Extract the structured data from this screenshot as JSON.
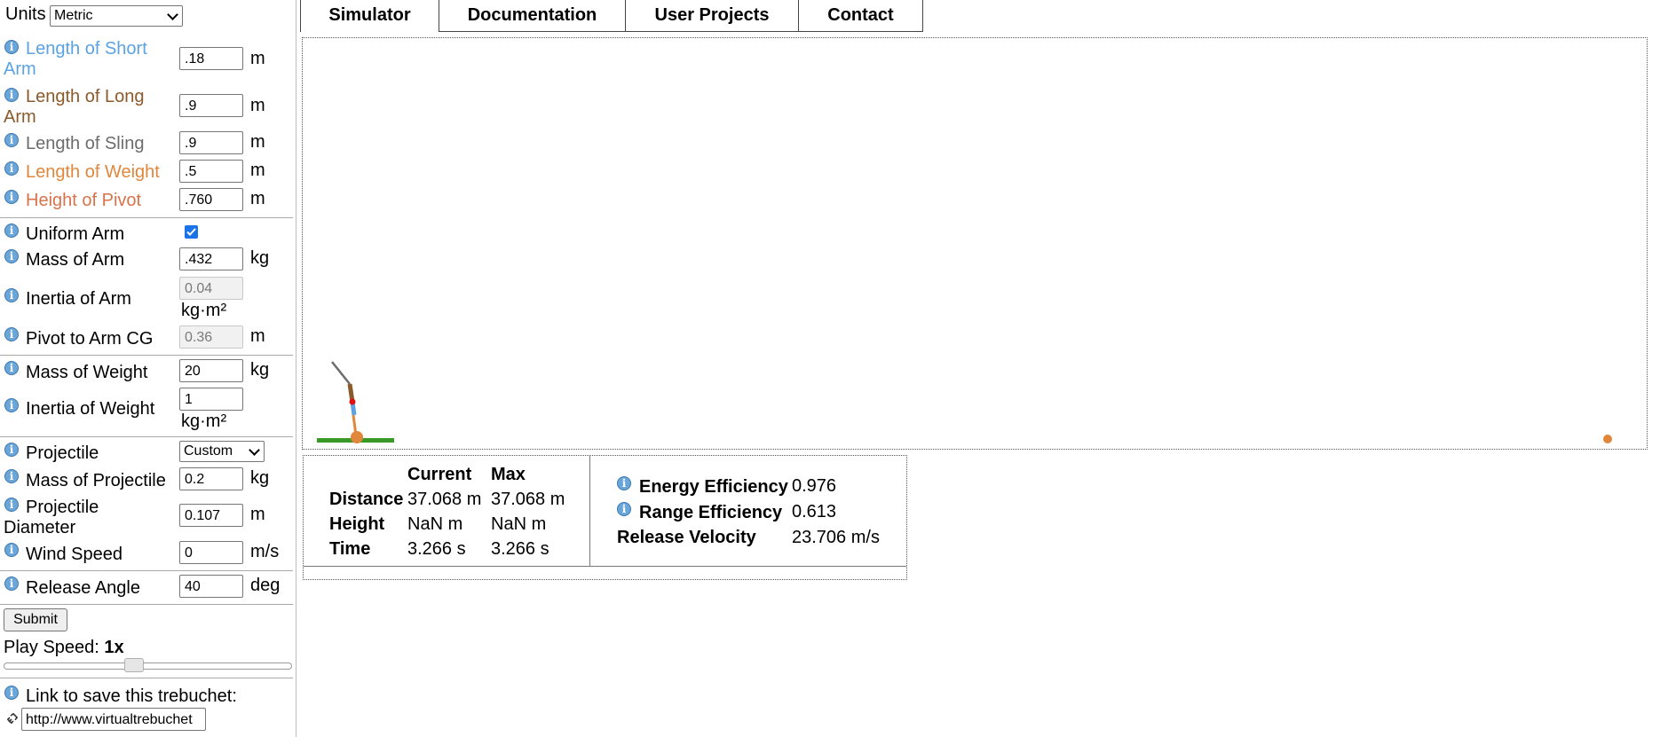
{
  "units": {
    "label": "Units",
    "value": "Metric"
  },
  "fields": {
    "short_arm": {
      "label": "Length of Short Arm",
      "value": ".18",
      "unit": "m",
      "color": "#5aa2e4"
    },
    "long_arm": {
      "label": "Length of Long Arm",
      "value": ".9",
      "unit": "m",
      "color": "#8b5a2b"
    },
    "sling": {
      "label": "Length of Sling",
      "value": ".9",
      "unit": "m",
      "color": "#6c6c6c"
    },
    "weight_len": {
      "label": "Length of Weight",
      "value": ".5",
      "unit": "m",
      "color": "#e0873c"
    },
    "pivot_height": {
      "label": "Height of Pivot",
      "value": ".760",
      "unit": "m",
      "color": "#d8734c"
    },
    "uniform_arm": {
      "label": "Uniform Arm",
      "checked": true
    },
    "arm_mass": {
      "label": "Mass of Arm",
      "value": ".432",
      "unit": "kg"
    },
    "arm_inertia": {
      "label": "Inertia of Arm",
      "value": "0.04",
      "unit": "kg·m²"
    },
    "arm_cg": {
      "label": "Pivot to Arm CG",
      "value": "0.36",
      "unit": "m"
    },
    "weight_mass": {
      "label": "Mass of Weight",
      "value": "20",
      "unit": "kg"
    },
    "weight_inertia": {
      "label": "Inertia of Weight",
      "value": "1",
      "unit": "kg·m²"
    },
    "projectile": {
      "label": "Projectile",
      "value": "Custom"
    },
    "proj_mass": {
      "label": "Mass of Projectile",
      "value": "0.2",
      "unit": "kg"
    },
    "proj_diameter": {
      "label": "Projectile Diameter",
      "value": "0.107",
      "unit": "m"
    },
    "wind": {
      "label": "Wind Speed",
      "value": "0",
      "unit": "m/s"
    },
    "release_angle": {
      "label": "Release Angle",
      "value": "40",
      "unit": "deg"
    }
  },
  "submit_label": "Submit",
  "play_speed": {
    "label": "Play Speed:",
    "value": "1x",
    "slider_fraction": 0.45
  },
  "save_link": {
    "label": "Link to save this trebuchet:",
    "value": "http://www.virtualtrebuchet"
  },
  "tabs": [
    "Simulator",
    "Documentation",
    "User Projects",
    "Contact"
  ],
  "active_tab": "Simulator",
  "results": {
    "headers": {
      "current": "Current",
      "max": "Max"
    },
    "rows": [
      {
        "label": "Distance",
        "current": "37.068 m",
        "max": "37.068 m"
      },
      {
        "label": "Height",
        "current": "NaN m",
        "max": "NaN m"
      },
      {
        "label": "Time",
        "current": "3.266 s",
        "max": "3.266 s"
      }
    ],
    "energy_efficiency": {
      "label": "Energy Efficiency",
      "value": "0.976"
    },
    "range_efficiency": {
      "label": "Range Efficiency",
      "value": "0.613"
    },
    "release_velocity": {
      "label": "Release Velocity",
      "value": "23.706 m/s"
    }
  },
  "colors": {
    "ground": "#3a9a28",
    "weight": "#e0873c",
    "projectile": "#e0873c",
    "sling": "#6c6c6c"
  }
}
